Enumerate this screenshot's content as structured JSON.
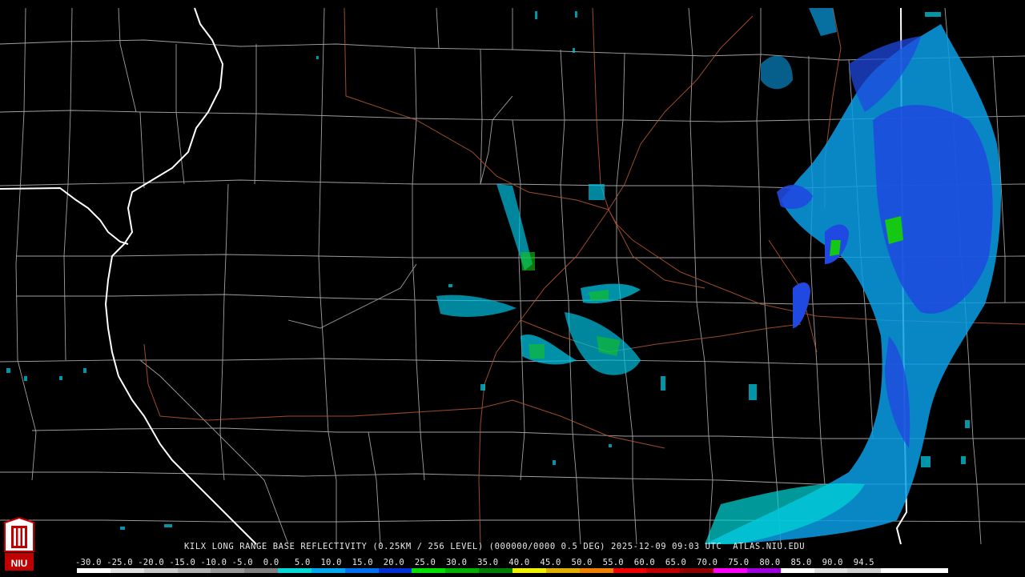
{
  "header": {
    "title": "KILX LONG RANGE BASE REFLECTIVITY (0.25KM / 256 LEVEL) (000000/0000 0.5 DEG) 2025-12-09 09:03 UTC  ATLAS.NIU.EDU"
  },
  "colorbar": {
    "labels": "-30.0 -25.0 -20.0 -15.0 -10.0 -5.0  0.0   5.0  10.0  15.0  20.0  25.0  30.0  35.0  40.0  45.0  50.0  55.0  60.0  65.0  70.0  75.0  80.0  85.0  90.0  94.5",
    "colors": [
      "#ffffff",
      "#e0e0e0",
      "#c8c8c8",
      "#b0b0b0",
      "#989898",
      "#808080",
      "#00d8d8",
      "#00a8f0",
      "#0070f0",
      "#0030d8",
      "#00e000",
      "#00b000",
      "#008000",
      "#f0f000",
      "#e0b000",
      "#f08000",
      "#f00000",
      "#c00000",
      "#900000",
      "#ff00ff",
      "#a000e0",
      "#ffffff",
      "#e0e0e0",
      "#d0d0d0",
      "#ffffff",
      "#ffffff"
    ]
  },
  "logo": {
    "text": "NIU"
  },
  "map": {
    "radar_site": "KILX",
    "colors": {
      "county": "#c8c8c8",
      "state": "#ffffff",
      "roads": "#b85a30"
    }
  }
}
